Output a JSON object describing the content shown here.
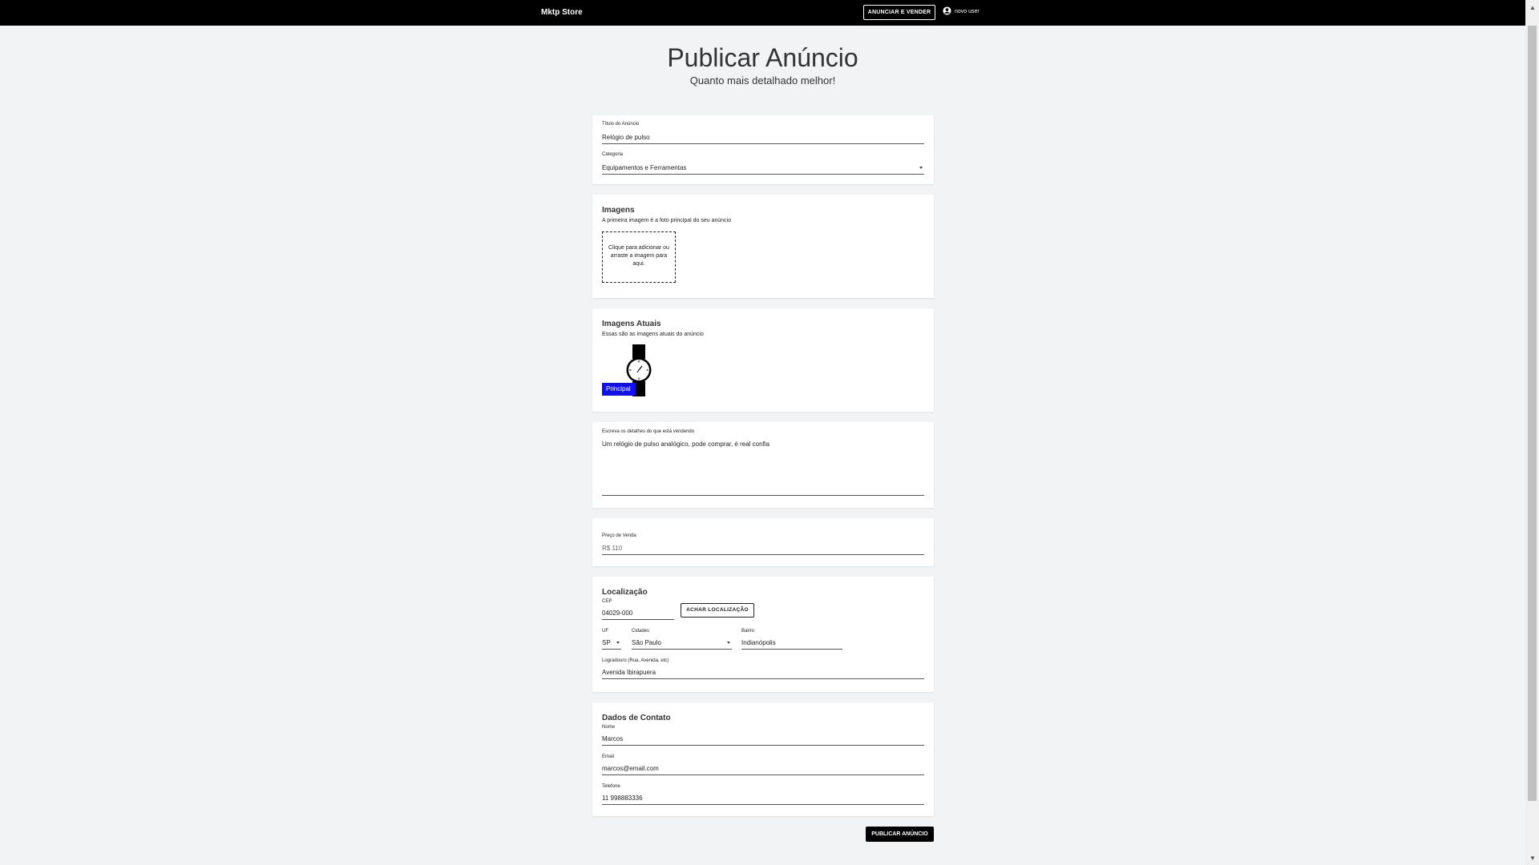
{
  "header": {
    "brand": "Mktp Store",
    "sell_button": "ANUNCIAR E VENDER",
    "user_name": "novo user",
    "user_icon": "user-circle-icon"
  },
  "page": {
    "title": "Publicar Anúncio",
    "subtitle": "Quanto mais detalhado melhor!"
  },
  "basic": {
    "title_label": "Título do Anúncio",
    "title_value": "Relógio de pulso",
    "category_label": "Categoria",
    "category_value": "Equipamentos e Ferramentas"
  },
  "images": {
    "title": "Imagens",
    "description": "A primeira imagem é a foto principal do seu anúncio",
    "dropzone_text": "Clique para adicionar ou arraste a imagem para aqui."
  },
  "current_images": {
    "title": "Imagens Atuais",
    "description": "Essas são as imagens atuais do anúncio",
    "badge": "Principal"
  },
  "details": {
    "label": "Escreva os detalhes do que está vendendo",
    "value": "Um relógio de pulso analógico, pode comprar, é real confia"
  },
  "price": {
    "label": "Preço de Venda",
    "value": "R$ 110"
  },
  "location": {
    "title": "Localização",
    "cep_label": "CEP",
    "cep_value": "04029-000",
    "find_button": "ACHAR LOCALIZAÇÃO",
    "uf_label": "UF",
    "uf_value": "SP",
    "city_label": "Cidades",
    "city_value": "São Paulo",
    "district_label": "Bairro",
    "district_value": "Indianópolis",
    "street_label": "Logradouro (Rua, Avenida, etc)",
    "street_value": "Avenida Ibirapuera"
  },
  "contact": {
    "title": "Dados de Contato",
    "name_label": "Nome",
    "name_value": "Marcos",
    "email_label": "Email",
    "email_value": "marcos@email.com",
    "phone_label": "Telefone",
    "phone_value": "11 998883336"
  },
  "submit_button": "PUBLICAR ANÚNCIO"
}
